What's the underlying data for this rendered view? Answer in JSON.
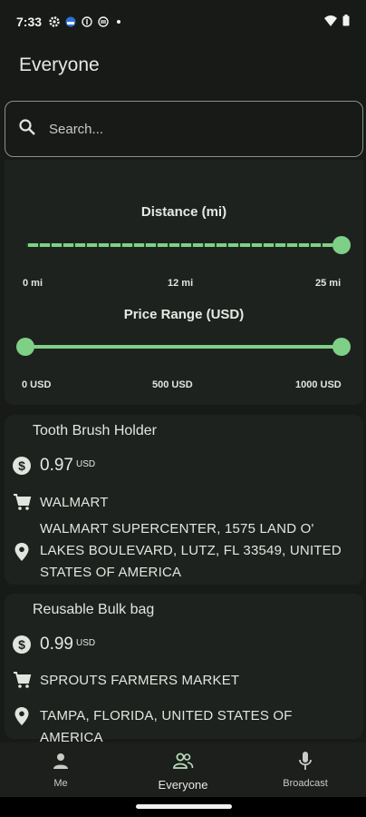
{
  "status_bar": {
    "time": "7:33",
    "icons": [
      "settings-icon",
      "shield-icon",
      "info-icon",
      "sync-icon",
      "dot-icon",
      "wifi-icon",
      "battery-icon"
    ]
  },
  "app_bar": {
    "title": "Everyone"
  },
  "search": {
    "placeholder": "Search..."
  },
  "filters": {
    "distance": {
      "label": "Distance (mi)",
      "min_label": "0 mi",
      "mid_label": "12 mi",
      "max_label": "25 mi",
      "value": 25
    },
    "price": {
      "label": "Price Range (USD)",
      "min_label": "0 USD",
      "mid_label": "500 USD",
      "max_label": "1000 USD",
      "range": [
        0,
        1000
      ]
    }
  },
  "listings": [
    {
      "name": "Tooth Brush Holder",
      "price": "0.97",
      "currency": "USD",
      "store": "WALMART",
      "address_lines": [
        "WALMART SUPERCENTER, 1575 LAND O'",
        "LAKES BOULEVARD, LUTZ, FL 33549, UNITED",
        "STATES OF AMERICA"
      ]
    },
    {
      "name": "Reusable Bulk bag",
      "price": "0.99",
      "currency": "USD",
      "store": "SPROUTS FARMERS MARKET",
      "address_lines": [
        "TAMPA, FLORIDA, UNITED STATES OF AMERICA"
      ]
    }
  ],
  "bottom_nav": {
    "items": [
      {
        "label": "Me",
        "icon": "person-icon"
      },
      {
        "label": "Everyone",
        "icon": "group-icon",
        "active": true
      },
      {
        "label": "Broadcast",
        "icon": "microphone-icon"
      }
    ]
  },
  "colors": {
    "accent": "#7fd087",
    "background": "#171a17",
    "card": "#1e221e"
  }
}
